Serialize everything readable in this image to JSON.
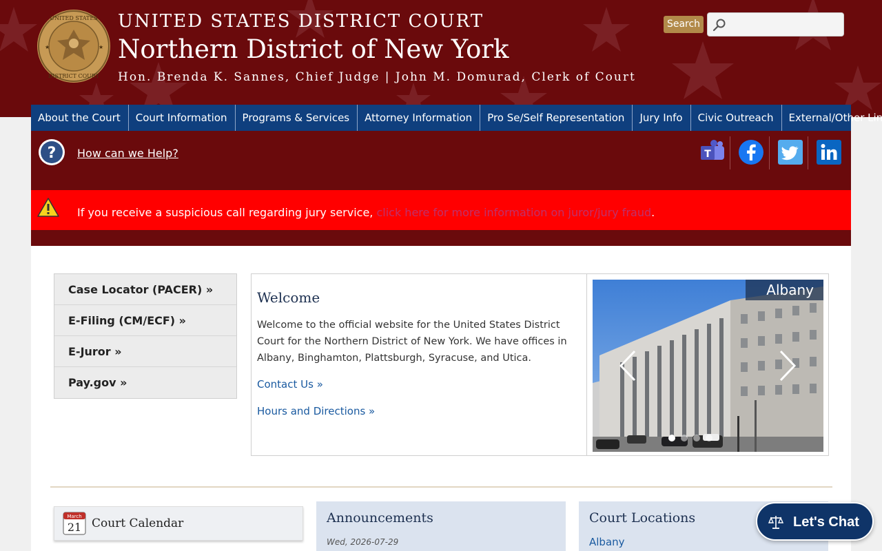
{
  "header": {
    "line1": "UNITED STATES DISTRICT COURT",
    "line2": "Northern District of New York",
    "line3": "Hon. Brenda K. Sannes, Chief Judge | John M. Domurad, Clerk of Court",
    "seal_text_top": "UNITED STATES",
    "seal_text_bottom": "DISTRICT COURT",
    "search_label": "Search",
    "search_placeholder": ""
  },
  "nav": {
    "items": [
      "About the Court",
      "Court Information",
      "Programs & Services",
      "Attorney Information",
      "Pro Se/Self Representation",
      "Jury Info",
      "Civic Outreach",
      "External/Other Links"
    ]
  },
  "help": {
    "link_label": "How can we Help?",
    "social_icons": [
      "teams-icon",
      "facebook-icon",
      "twitter-icon",
      "linkedin-icon"
    ]
  },
  "alert": {
    "text": "If you receive a suspicious call regarding jury service, ",
    "link": "click here for more information on juror/jury fraud",
    "end": "."
  },
  "quick_links": [
    "Case Locator (PACER) »",
    "E-Filing (CM/ECF) »",
    "E-Juror »",
    "Pay.gov »"
  ],
  "welcome": {
    "title": "Welcome",
    "text": "Welcome to the official website for the United States District Court for the Northern District of New York. We have offices in Albany, Binghamton, Plattsburgh, Syracuse, and Utica.",
    "contact_link": "Contact Us »",
    "hours_link": "Hours and Directions »"
  },
  "carousel": {
    "caption": "Albany",
    "slide_count": 4,
    "active_slide": 1
  },
  "calendar": {
    "month": "March",
    "day": "21",
    "label": "Court Calendar"
  },
  "announcements": {
    "title": "Announcements",
    "date": "Wed, 2026-07-29"
  },
  "locations": {
    "title": "Court Locations",
    "first": "Albany"
  },
  "chat": {
    "label": "Let's Chat"
  },
  "colors": {
    "header_bg": "#6a0a0c",
    "nav_bg": "#0f3f7e",
    "alert_bg": "#ff0000",
    "link": "#1a5aa0",
    "chat_bg": "#0f3468"
  }
}
